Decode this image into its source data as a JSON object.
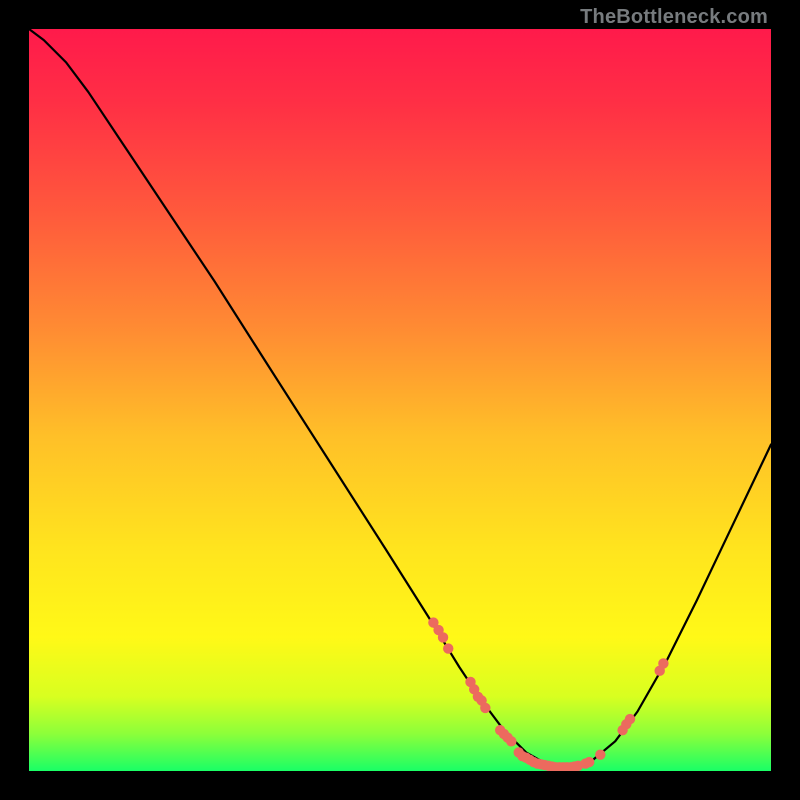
{
  "watermark": "TheBottleneck.com",
  "chart_data": {
    "type": "line",
    "title": "",
    "xlabel": "",
    "ylabel": "",
    "xlim": [
      0,
      100
    ],
    "ylim": [
      0,
      100
    ],
    "grid": false,
    "gradient_stops": [
      {
        "offset": 0.0,
        "color": "#ff1a4b"
      },
      {
        "offset": 0.1,
        "color": "#ff2f45"
      },
      {
        "offset": 0.25,
        "color": "#ff5a3c"
      },
      {
        "offset": 0.4,
        "color": "#ff8a33"
      },
      {
        "offset": 0.55,
        "color": "#ffc028"
      },
      {
        "offset": 0.7,
        "color": "#ffe41e"
      },
      {
        "offset": 0.82,
        "color": "#fff917"
      },
      {
        "offset": 0.9,
        "color": "#d8ff20"
      },
      {
        "offset": 0.95,
        "color": "#8cff3a"
      },
      {
        "offset": 1.0,
        "color": "#19ff66"
      }
    ],
    "series": [
      {
        "name": "curve",
        "color": "#000000",
        "width": 2.2,
        "points": [
          {
            "x": 0.0,
            "y": 100.0
          },
          {
            "x": 2.0,
            "y": 98.5
          },
          {
            "x": 5.0,
            "y": 95.5
          },
          {
            "x": 8.0,
            "y": 91.5
          },
          {
            "x": 12.0,
            "y": 85.5
          },
          {
            "x": 18.0,
            "y": 76.5
          },
          {
            "x": 25.0,
            "y": 66.0
          },
          {
            "x": 32.0,
            "y": 55.0
          },
          {
            "x": 40.0,
            "y": 42.5
          },
          {
            "x": 48.0,
            "y": 30.0
          },
          {
            "x": 54.0,
            "y": 20.5
          },
          {
            "x": 58.0,
            "y": 14.0
          },
          {
            "x": 61.0,
            "y": 9.5
          },
          {
            "x": 64.0,
            "y": 5.5
          },
          {
            "x": 67.0,
            "y": 2.5
          },
          {
            "x": 70.0,
            "y": 0.8
          },
          {
            "x": 73.0,
            "y": 0.5
          },
          {
            "x": 76.0,
            "y": 1.5
          },
          {
            "x": 79.0,
            "y": 4.0
          },
          {
            "x": 82.0,
            "y": 8.0
          },
          {
            "x": 86.0,
            "y": 15.0
          },
          {
            "x": 90.0,
            "y": 23.0
          },
          {
            "x": 95.0,
            "y": 33.5
          },
          {
            "x": 100.0,
            "y": 44.0
          }
        ]
      }
    ],
    "scatter": {
      "color": "#ec6a5e",
      "radius": 5.2,
      "points": [
        {
          "x": 54.5,
          "y": 20.0
        },
        {
          "x": 55.2,
          "y": 19.0
        },
        {
          "x": 55.8,
          "y": 18.0
        },
        {
          "x": 56.5,
          "y": 16.5
        },
        {
          "x": 59.5,
          "y": 12.0
        },
        {
          "x": 60.0,
          "y": 11.0
        },
        {
          "x": 60.5,
          "y": 10.0
        },
        {
          "x": 61.0,
          "y": 9.5
        },
        {
          "x": 61.5,
          "y": 8.5
        },
        {
          "x": 63.5,
          "y": 5.5
        },
        {
          "x": 64.0,
          "y": 5.0
        },
        {
          "x": 64.5,
          "y": 4.5
        },
        {
          "x": 65.0,
          "y": 4.0
        },
        {
          "x": 66.0,
          "y": 2.5
        },
        {
          "x": 66.5,
          "y": 2.0
        },
        {
          "x": 67.0,
          "y": 1.8
        },
        {
          "x": 67.5,
          "y": 1.5
        },
        {
          "x": 68.0,
          "y": 1.2
        },
        {
          "x": 68.5,
          "y": 1.0
        },
        {
          "x": 69.0,
          "y": 0.9
        },
        {
          "x": 69.5,
          "y": 0.8
        },
        {
          "x": 70.0,
          "y": 0.7
        },
        {
          "x": 70.5,
          "y": 0.6
        },
        {
          "x": 71.0,
          "y": 0.5
        },
        {
          "x": 71.5,
          "y": 0.5
        },
        {
          "x": 72.0,
          "y": 0.5
        },
        {
          "x": 72.5,
          "y": 0.5
        },
        {
          "x": 73.0,
          "y": 0.5
        },
        {
          "x": 73.5,
          "y": 0.6
        },
        {
          "x": 74.0,
          "y": 0.7
        },
        {
          "x": 75.0,
          "y": 1.0
        },
        {
          "x": 75.5,
          "y": 1.2
        },
        {
          "x": 77.0,
          "y": 2.2
        },
        {
          "x": 80.0,
          "y": 5.5
        },
        {
          "x": 80.5,
          "y": 6.3
        },
        {
          "x": 81.0,
          "y": 7.0
        },
        {
          "x": 85.0,
          "y": 13.5
        },
        {
          "x": 85.5,
          "y": 14.5
        }
      ]
    }
  }
}
